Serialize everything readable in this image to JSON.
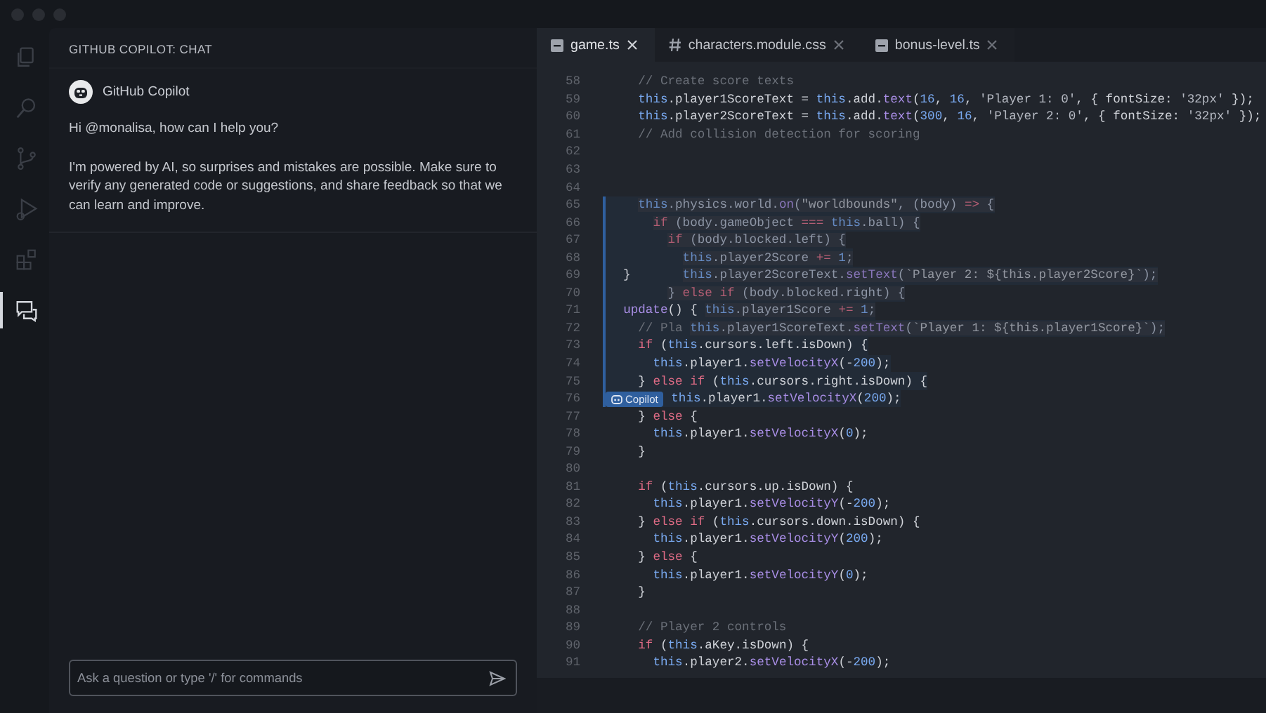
{
  "activity_bar": [
    {
      "kind": "files",
      "selected": false
    },
    {
      "kind": "search",
      "selected": false
    },
    {
      "kind": "branch",
      "selected": false
    },
    {
      "kind": "run",
      "selected": false
    },
    {
      "kind": "extensions",
      "selected": false
    },
    {
      "kind": "chat",
      "selected": true
    }
  ],
  "chat": {
    "header": "GITHUB COPILOT: CHAT",
    "author": "GitHub Copilot",
    "messages": [
      "Hi @monalisa, how can I help you?",
      "I'm powered by AI, so surprises and mistakes are possible. Make sure to verify any generated code or suggestions, and share feedback so that we can learn and improve."
    ],
    "input": {
      "placeholder": "Ask a question or type '/' for commands"
    }
  },
  "tabs": [
    {
      "label": "game.ts",
      "kind": "ts",
      "selected": true
    },
    {
      "label": "characters.module.css",
      "kind": "css",
      "selected": false
    },
    {
      "label": "bonus-level.ts",
      "kind": "ts",
      "selected": false
    }
  ],
  "code_lines": [
    {
      "number": "58",
      "suggestion": false,
      "segments": [
        {
          "kind": "code",
          "text": "    // Create score texts"
        }
      ]
    },
    {
      "number": "59",
      "suggestion": false,
      "segments": [
        {
          "kind": "code",
          "text": "    this.player1ScoreText = this.add.text(16, 16, 'Player 1: 0', { fontSize: '32px' });"
        }
      ]
    },
    {
      "number": "60",
      "suggestion": false,
      "segments": [
        {
          "kind": "code",
          "text": "    this.player2ScoreText = this.add.text(300, 16, 'Player 2: 0', { fontSize: '32px' });"
        }
      ]
    },
    {
      "number": "61",
      "suggestion": false,
      "segments": [
        {
          "kind": "code",
          "text": "    // Add collision detection for scoring"
        }
      ]
    },
    {
      "number": "62",
      "suggestion": false
    },
    {
      "number": "63",
      "suggestion": false
    },
    {
      "number": "64",
      "suggestion": false
    },
    {
      "number": "65",
      "suggestion": true,
      "segments": [
        {
          "kind": "ghost",
          "text": "    this.physics.world.on(\"worldbounds\", (body) => {"
        }
      ]
    },
    {
      "number": "66",
      "suggestion": true,
      "segments": [
        {
          "kind": "ghost",
          "text": "      if (body.gameObject === this.ball) {"
        }
      ]
    },
    {
      "number": "67",
      "suggestion": true,
      "segments": [
        {
          "kind": "ghost",
          "text": "        if (body.blocked.left) {"
        }
      ]
    },
    {
      "number": "68",
      "suggestion": true,
      "segments": [
        {
          "kind": "ghost",
          "text": "          this.player2Score += 1;"
        }
      ]
    },
    {
      "number": "69",
      "suggestion": true,
      "segments": [
        {
          "kind": "code",
          "text": "  }"
        },
        {
          "kind": "ghost",
          "text": "       this.player2ScoreText.setText(`Player 2: ${this.player2Score}`);"
        }
      ]
    },
    {
      "number": "70",
      "suggestion": true,
      "segments": [
        {
          "kind": "ghost",
          "text": "        } else if (body.blocked.right) {"
        }
      ]
    },
    {
      "number": "71",
      "suggestion": true,
      "segments": [
        {
          "kind": "code",
          "text": "  update() {"
        },
        {
          "kind": "ghost",
          "text": " this.player1Score += 1;"
        }
      ]
    },
    {
      "number": "72",
      "suggestion": true,
      "segments": [
        {
          "kind": "code",
          "text": "    // Pla"
        },
        {
          "kind": "ghost",
          "text": " this.player1ScoreText.setText(`Player 1: ${this.player1Score}`);"
        }
      ]
    },
    {
      "number": "73",
      "suggestion": true,
      "segments": [
        {
          "kind": "code",
          "text": "    if (this.cursors.left.isDown) {"
        }
      ]
    },
    {
      "number": "74",
      "suggestion": true,
      "segments": [
        {
          "kind": "code",
          "text": "      this.player1.setVelocityX(-200);"
        }
      ]
    },
    {
      "number": "75",
      "suggestion": true,
      "segments": [
        {
          "kind": "code",
          "text": "    } else if (this.cursors.right.isDown) {"
        }
      ]
    },
    {
      "number": "76",
      "suggestion": true,
      "segments": [
        {
          "kind": "badge",
          "text": "Copilot"
        },
        {
          "kind": "code",
          "text": " this.player1.setVelocityX(200);"
        }
      ]
    },
    {
      "number": "77",
      "suggestion": false,
      "segments": [
        {
          "kind": "code",
          "text": "    } else {"
        }
      ]
    },
    {
      "number": "78",
      "suggestion": false,
      "segments": [
        {
          "kind": "code",
          "text": "      this.player1.setVelocityX(0);"
        }
      ]
    },
    {
      "number": "79",
      "suggestion": false,
      "segments": [
        {
          "kind": "code",
          "text": "    }"
        }
      ]
    },
    {
      "number": "80",
      "suggestion": false
    },
    {
      "number": "81",
      "suggestion": false,
      "segments": [
        {
          "kind": "code",
          "text": "    if (this.cursors.up.isDown) {"
        }
      ]
    },
    {
      "number": "82",
      "suggestion": false,
      "segments": [
        {
          "kind": "code",
          "text": "      this.player1.setVelocityY(-200);"
        }
      ]
    },
    {
      "number": "83",
      "suggestion": false,
      "segments": [
        {
          "kind": "code",
          "text": "    } else if (this.cursors.down.isDown) {"
        }
      ]
    },
    {
      "number": "84",
      "suggestion": false,
      "segments": [
        {
          "kind": "code",
          "text": "      this.player1.setVelocityY(200);"
        }
      ]
    },
    {
      "number": "85",
      "suggestion": false,
      "segments": [
        {
          "kind": "code",
          "text": "    } else {"
        }
      ]
    },
    {
      "number": "86",
      "suggestion": false,
      "segments": [
        {
          "kind": "code",
          "text": "      this.player1.setVelocityY(0);"
        }
      ]
    },
    {
      "number": "87",
      "suggestion": false,
      "segments": [
        {
          "kind": "code",
          "text": "    }"
        }
      ]
    },
    {
      "number": "88",
      "suggestion": false
    },
    {
      "number": "89",
      "suggestion": false,
      "segments": [
        {
          "kind": "code",
          "text": "    // Player 2 controls"
        }
      ]
    },
    {
      "number": "90",
      "suggestion": false,
      "segments": [
        {
          "kind": "code",
          "text": "    if (this.aKey.isDown) {"
        }
      ]
    },
    {
      "number": "91",
      "suggestion": false,
      "segments": [
        {
          "kind": "code",
          "text": "      this.player2.setVelocityX(-200);"
        }
      ]
    }
  ]
}
